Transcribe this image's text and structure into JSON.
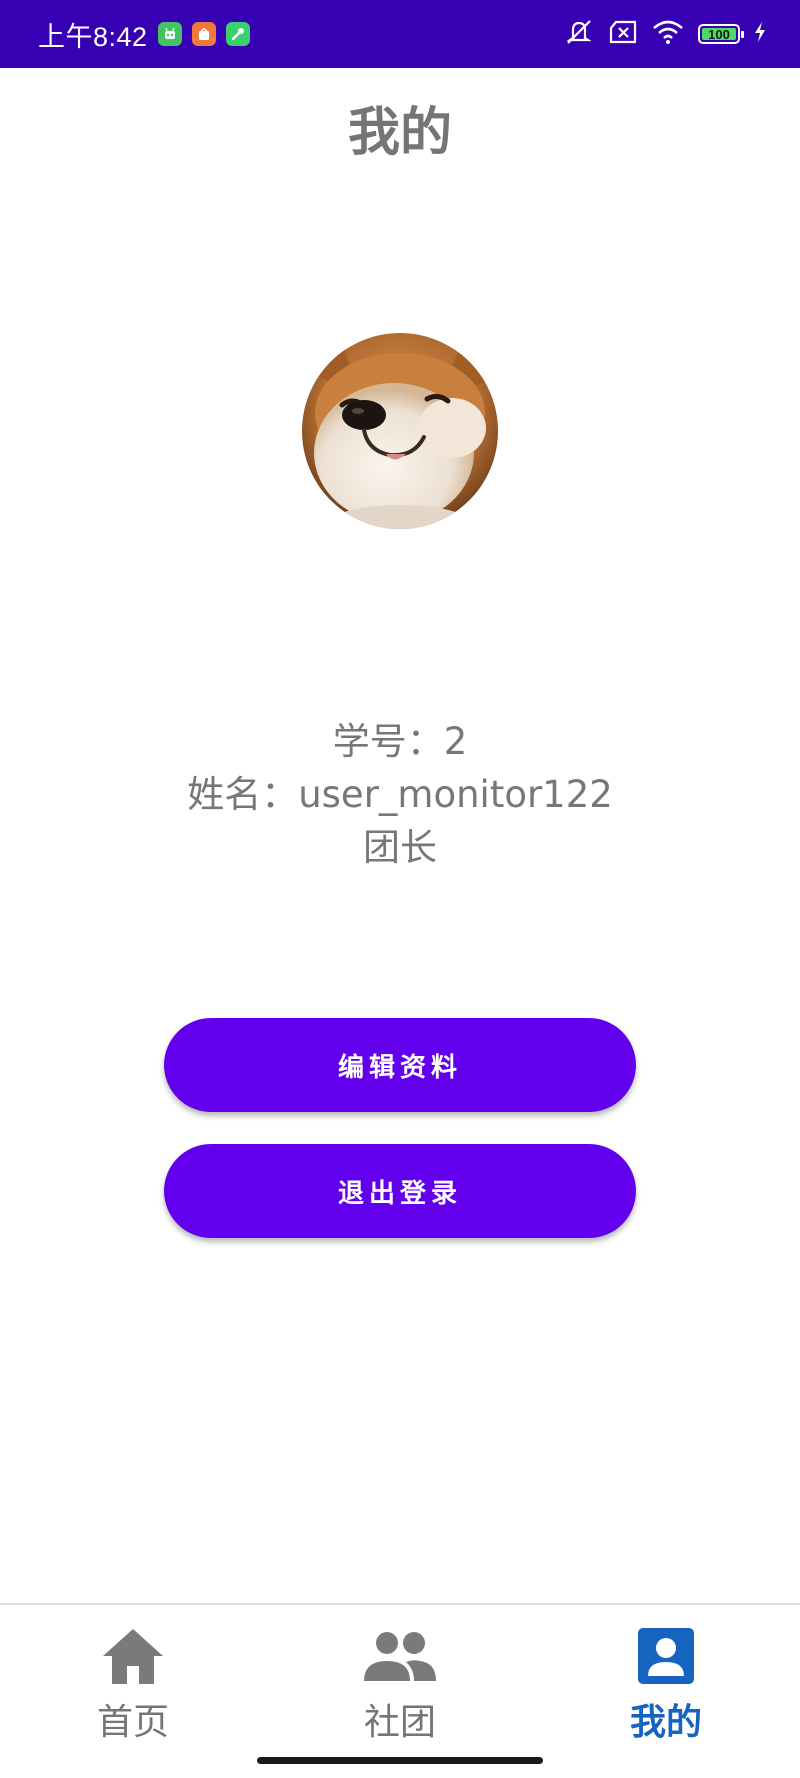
{
  "status_bar": {
    "time": "上午8:42",
    "battery": "100",
    "colors": {
      "background": "#3700b3"
    },
    "app_icons": [
      "green-robot-icon",
      "orange-shop-icon",
      "green-tool-icon"
    ],
    "system_icons": [
      "mute-icon",
      "no-sim-icon",
      "wifi-icon",
      "battery-icon",
      "charging-icon"
    ]
  },
  "header": {
    "title": "我的"
  },
  "profile": {
    "avatar_icon": "shiba-dog-avatar",
    "student_id": "学号：2",
    "name": "姓名：user_monitor122",
    "role": "团长"
  },
  "actions": {
    "edit_label": "编辑资料",
    "logout_label": "退出登录",
    "accent": "#6200ee"
  },
  "bottom_nav": {
    "items": [
      {
        "label": "首页",
        "icon": "home-icon",
        "active": false
      },
      {
        "label": "社团",
        "icon": "group-icon",
        "active": false
      },
      {
        "label": "我的",
        "icon": "account-box-icon",
        "active": true
      }
    ],
    "active_color": "#1565c0",
    "inactive_color": "#757575"
  }
}
